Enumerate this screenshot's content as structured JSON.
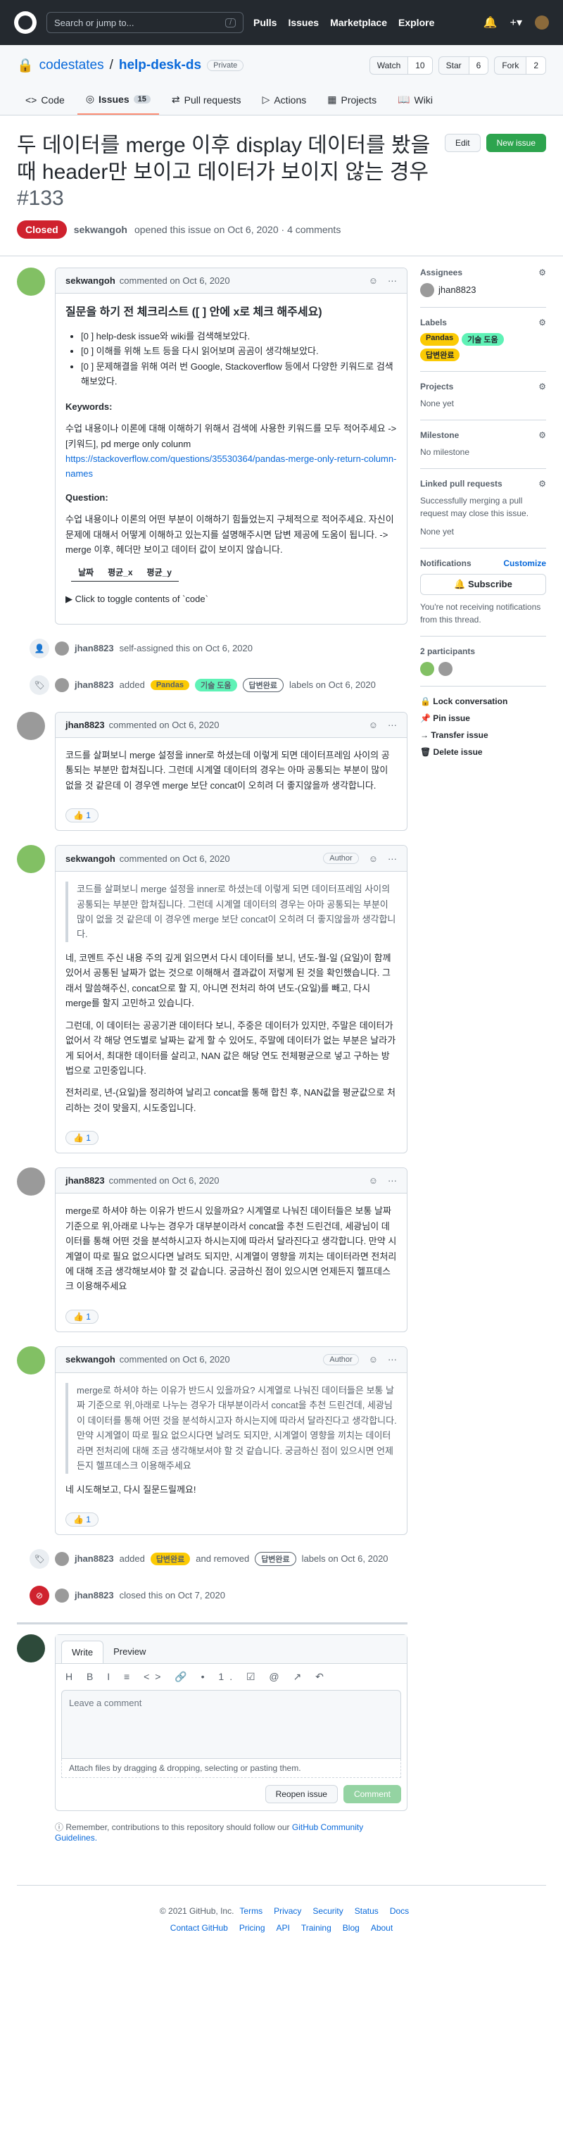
{
  "nav": {
    "search": "Search or jump to...",
    "slash": "/",
    "links": [
      "Pulls",
      "Issues",
      "Marketplace",
      "Explore"
    ]
  },
  "repo": {
    "owner": "codestates",
    "name": "help-desk-ds",
    "visibility": "Private",
    "watch": "Watch",
    "watch_count": "10",
    "star": "Star",
    "star_count": "6",
    "fork": "Fork",
    "fork_count": "2"
  },
  "tabs": [
    {
      "label": "Code"
    },
    {
      "label": "Issues",
      "count": "15"
    },
    {
      "label": "Pull requests"
    },
    {
      "label": "Actions"
    },
    {
      "label": "Projects"
    },
    {
      "label": "Wiki"
    }
  ],
  "issue": {
    "title": "두 데이터를 merge 이후 display 데이터를 봤을 때 header만 보이고 데이터가 보이지 않는 경우",
    "number": "#133",
    "edit": "Edit",
    "new": "New issue",
    "status": "Closed",
    "meta_user": "sekwangoh",
    "meta_text": "opened this issue on Oct 6, 2020 · 4 comments"
  },
  "c1": {
    "user": "sekwangoh",
    "time": "commented on Oct 6, 2020",
    "heading": "질문을 하기 전 체크리스트 ([ ] 안에 x로 체크 해주세요)",
    "items": [
      "[0 ] help-desk issue와 wiki를 검색해보았다.",
      "[0 ] 이해를 위해 노트 등을 다시 읽어보며 곰곰이 생각해보았다.",
      "[0 ] 문제해결을 위해 여러 번 Google, Stackoverflow 등에서 다양한 키워드로 검색해보았다."
    ],
    "kw": "Keywords:",
    "kw_text": "수업 내용이나 이론에 대해 이해하기 위해서 검색에 사용한 키워드를 모두 적어주세요 -> [키워드], pd merge only colunm",
    "link": "https://stackoverflow.com/questions/35530364/pandas-merge-only-return-column-names",
    "q": "Question:",
    "q_text": "수업 내용이나 이론의 어떤 부분이 이해하기 힘들었는지 구체적으로 적어주세요. 자신이 문제에 대해서 어떻게 이해하고 있는지를 설명해주시면 답변 제공에 도움이 됩니다. -> merge 이후, 헤더만 보이고 데이터 값이 보이지 않습니다.",
    "table": [
      "날짜",
      "평균_x",
      "평균_y"
    ],
    "toggle": "▶ Click to toggle contents of `code`"
  },
  "e1": {
    "user": "jhan8823",
    "text": "self-assigned this on Oct 6, 2020"
  },
  "e2": {
    "user": "jhan8823",
    "pre": "added",
    "labels": [
      "Pandas",
      "기술 도움",
      "답변완료"
    ],
    "post": "labels on Oct 6, 2020"
  },
  "c2": {
    "user": "jhan8823",
    "time": "commented on Oct 6, 2020",
    "body": "코드를 살펴보니 merge 설정을 inner로 하셨는데 이렇게 되면 데이터프레임 사이의 공통되는 부분만 합쳐집니다. 그런데 시계열 데이터의 경우는 아마 공통되는 부분이 많이 없을 것 같은데 이 경우엔 merge 보단 concat이 오히려 더 좋지않을까 생각합니다.",
    "react": "👍 1"
  },
  "c3": {
    "user": "sekwangoh",
    "time": "commented on Oct 6, 2020",
    "author": "Author",
    "quote": "코드를 살펴보니 merge 설정을 inner로 하셨는데 이렇게 되면 데이터프레임 사이의 공통되는 부분만 합쳐집니다. 그런데 시계열 데이터의 경우는 아마 공통되는 부분이 많이 없을 것 같은데 이 경우엔 merge 보단 concat이 오히려 더 좋지않을까 생각합니다.",
    "p1": "네, 코멘트 주신 내용 주의 깊게 읽으면서 다시 데이터를 보니, 년도-월-일 (요일)이 함께 있어서 공통된 날짜가 없는 것으로 이해해서 결과값이 저렇게 된 것을 확인했습니다. 그래서 말씀해주신, concat으로 할 지, 아니면 전처리 하여 년도-(요일)를 빼고, 다시 merge를 할지 고민하고 있습니다.",
    "p2": "그런데, 이 데이터는 공공기관 데이터다 보니, 주중은 데이터가 있지만, 주말은 데이터가 없어서 각 해당 연도별로 날짜는 같게 할 수 있어도, 주말에 데이터가 없는 부분은 날라가게 되어서, 최대한 데이터를 살리고, NAN 값은 해당 연도 전체평균으로 넣고 구하는 방법으로 고민중입니다.",
    "p3": "전처리로, 년-(요일)을 정리하여 날리고 concat을 통해 합친 후, NAN값을 평균값으로 처리하는 것이 맞을지, 시도중입니다.",
    "react": "👍 1"
  },
  "c4": {
    "user": "jhan8823",
    "time": "commented on Oct 6, 2020",
    "body": "merge로 하셔야 하는 이유가 반드시 있을까요? 시계열로 나눠진 데이터들은 보통 날짜 기준으로 위,아래로 나누는 경우가 대부분이라서 concat을 추천 드린건데, 세광님이 데이터를 통해 어떤 것을 분석하시고자 하시는지에 따라서 달라진다고 생각합니다. 만약 시계열이 따로 필요 없으시다면 날려도 되지만, 시계열이 영향을 끼치는 데이터라면 전처리에 대해 조금 생각해보셔야 할 것 같습니다. 궁금하신 점이 있으시면 언제든지 헬프데스크 이용해주세요",
    "react": "👍 1"
  },
  "c5": {
    "user": "sekwangoh",
    "time": "commented on Oct 6, 2020",
    "author": "Author",
    "quote": "merge로 하셔야 하는 이유가 반드시 있을까요? 시계열로 나눠진 데이터들은 보통 날짜 기준으로 위,아래로 나누는 경우가 대부분이라서 concat을 추천 드린건데, 세광님이 데이터를 통해 어떤 것을 분석하시고자 하시는지에 따라서 달라진다고 생각합니다. 만약 시계열이 따로 필요 없으시다면 날려도 되지만, 시계열이 영향을 끼치는 데이터라면 전처리에 대해 조금 생각해보셔야 할 것 같습니다. 궁금하신 점이 있으시면 언제든지 헬프데스크 이용해주세요",
    "body": "네 시도해보고, 다시 질문드릴께요!",
    "react": "👍 1"
  },
  "e3": {
    "user": "jhan8823",
    "pre": "added",
    "added": "답변완료",
    "mid": "and removed",
    "removed": "답변완료",
    "post": "labels on Oct 6, 2020"
  },
  "e4": {
    "user": "jhan8823",
    "text": "closed this on Oct 7, 2020"
  },
  "editor": {
    "write": "Write",
    "preview": "Preview",
    "placeholder": "Leave a comment",
    "attach": "Attach files by dragging & dropping, selecting or pasting them.",
    "reopen": "Reopen issue",
    "comment": "Comment",
    "note": "Remember, contributions to this repository should follow our",
    "guidelines": "GitHub Community Guidelines."
  },
  "sidebar": {
    "assignees": "Assignees",
    "assignee": "jhan8823",
    "labels": "Labels",
    "label_list": [
      "Pandas",
      "기술 도움",
      "답변완료"
    ],
    "projects": "Projects",
    "none_yet": "None yet",
    "milestone": "Milestone",
    "no_milestone": "No milestone",
    "linked": "Linked pull requests",
    "linked_text": "Successfully merging a pull request may close this issue.",
    "notifications": "Notifications",
    "customize": "Customize",
    "subscribe": "Subscribe",
    "notif_text": "You're not receiving notifications from this thread.",
    "participants": "2 participants",
    "lock": "Lock conversation",
    "pin": "Pin issue",
    "transfer": "Transfer issue",
    "delete": "Delete issue"
  },
  "footer": {
    "copy": "© 2021 GitHub, Inc.",
    "row1": [
      "Terms",
      "Privacy",
      "Security",
      "Status",
      "Docs"
    ],
    "row2": [
      "Contact GitHub",
      "Pricing",
      "API",
      "Training",
      "Blog",
      "About"
    ]
  },
  "colors": {
    "pandas": "#fbca04",
    "tech": "#5ff2b6",
    "done": "#e6e6e6",
    "closed": "#cf222e",
    "green": "#2da44e"
  }
}
